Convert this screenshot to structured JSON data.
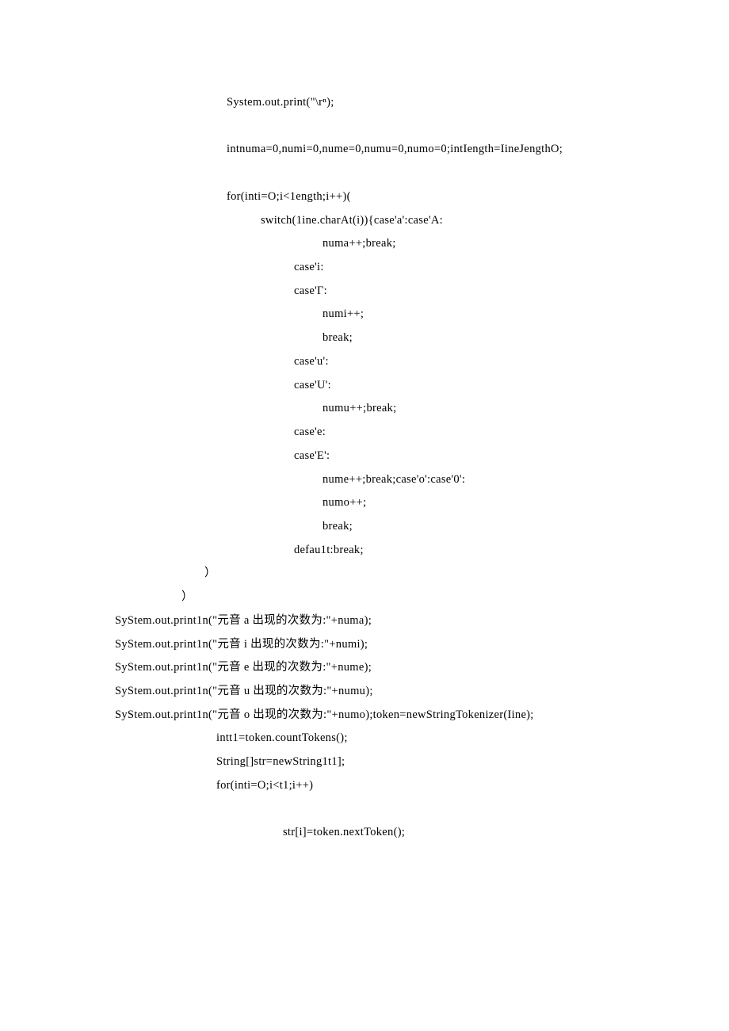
{
  "lines": {
    "l1": "System.out.print(\"\\rⁿ);",
    "l2": "intnuma=0,numi=0,nume=0,numu=0,numo=0;intIength=IineJengthO;",
    "l3": "for(inti=O;i<1ength;i++)(",
    "l4": "switch(1ine.charAt(i)){case'a':case'A:",
    "l5": "numa++;break;",
    "l6": "case'i:",
    "l7": "case'Γ:",
    "l8": "numi++;",
    "l9": "break;",
    "l10": "case'u':",
    "l11": "case'U':",
    "l12": "numu++;break;",
    "l13": "case'e:",
    "l14": "case'E':",
    "l15": "nume++;break;case'o':case'0':",
    "l16": "numo++;",
    "l17": "break;",
    "l18": "defau1t:break;",
    "l19": "）",
    "l20": "）",
    "l21": "SyStem.out.print1n(\"元音 a 出现的次数为:\"+numa);",
    "l22": "SyStem.out.print1n(\"元音 i 出现的次数为:\"+numi);",
    "l23": "SyStem.out.print1n(\"元音 e 出现的次数为:\"+nume);",
    "l24": "SyStem.out.print1n(\"元音 u 出现的次数为:\"+numu);",
    "l25": "SyStem.out.print1n(\"元音 o 出现的次数为:\"+numo);token=newStringTokenizer(Iine);",
    "l26": "intt1=token.countTokens();",
    "l27": "String[]str=newString1t1];",
    "l28": "for(inti=O;i<t1;i++)",
    "l29": "str[i]=token.nextToken();"
  }
}
